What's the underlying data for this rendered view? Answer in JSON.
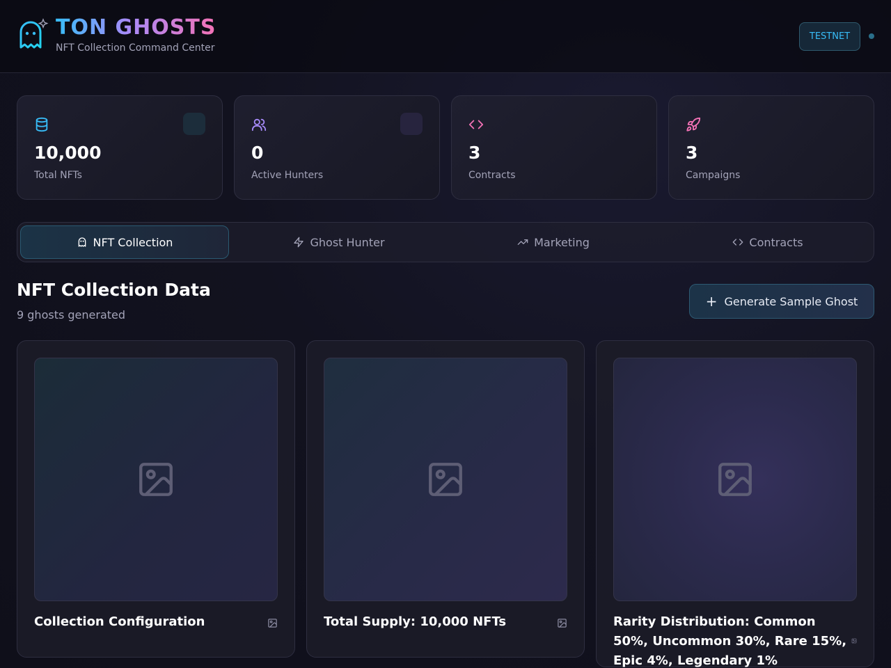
{
  "header": {
    "title": "TON GHOSTS",
    "subtitle": "NFT Collection Command Center",
    "network_badge": "TESTNET",
    "logo_icon": "ghost-sparkle-icon"
  },
  "stats": [
    {
      "value": "10,000",
      "label": "Total NFTs",
      "icon": "database-icon",
      "color": "#38bdf8"
    },
    {
      "value": "0",
      "label": "Active Hunters",
      "icon": "users-icon",
      "color": "#a78bfa"
    },
    {
      "value": "3",
      "label": "Contracts",
      "icon": "code-icon",
      "color": "#f472b6"
    },
    {
      "value": "3",
      "label": "Campaigns",
      "icon": "rocket-icon",
      "color": "#f472b6"
    }
  ],
  "tabs": [
    {
      "label": "NFT Collection",
      "icon": "ghost-icon",
      "active": true
    },
    {
      "label": "Ghost Hunter",
      "icon": "zap-icon",
      "active": false
    },
    {
      "label": "Marketing",
      "icon": "trending-up-icon",
      "active": false
    },
    {
      "label": "Contracts",
      "icon": "code-icon",
      "active": false
    }
  ],
  "section": {
    "title": "NFT Collection Data",
    "subtitle": "9 ghosts generated",
    "generate_button": "Generate Sample Ghost"
  },
  "ghosts": [
    {
      "name": "Collection Configuration",
      "image_icon": "image-icon"
    },
    {
      "name": "Total Supply: 10,000 NFTs",
      "image_icon": "image-icon"
    },
    {
      "name": "Rarity Distribution: Common 50%, Uncommon 30%, Rare 15%, Epic 4%, Legendary 1%",
      "image_icon": "image-icon"
    }
  ],
  "colors": {
    "accent_cyan": "#38bdf8",
    "accent_purple": "#a78bfa",
    "accent_pink": "#f472b6",
    "background": "#12121f"
  }
}
